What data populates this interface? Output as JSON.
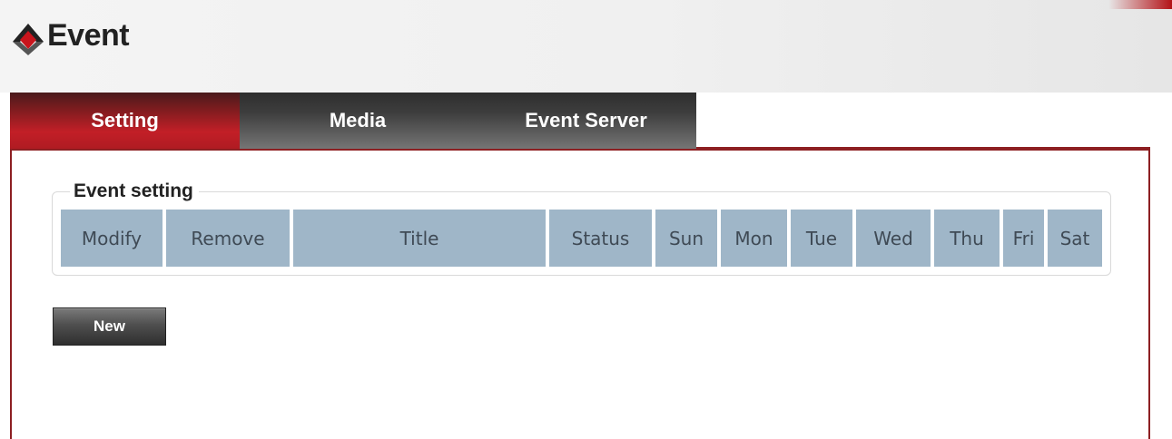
{
  "header": {
    "title": "Event",
    "logo_icon": "camera-brand-logo-icon"
  },
  "tabs": [
    {
      "label": "Setting",
      "active": true
    },
    {
      "label": "Media",
      "active": false
    },
    {
      "label": "Event Server",
      "active": false
    }
  ],
  "event_setting": {
    "legend": "Event setting",
    "columns": [
      "Modify",
      "Remove",
      "Title",
      "Status",
      "Sun",
      "Mon",
      "Tue",
      "Wed",
      "Thu",
      "Fri",
      "Sat"
    ],
    "rows": []
  },
  "actions": {
    "new_label": "New"
  },
  "colors": {
    "accent": "#c21f27",
    "border": "#8d1f22",
    "table_header_bg": "#9fb6c8",
    "table_header_text": "#3f4a55"
  }
}
